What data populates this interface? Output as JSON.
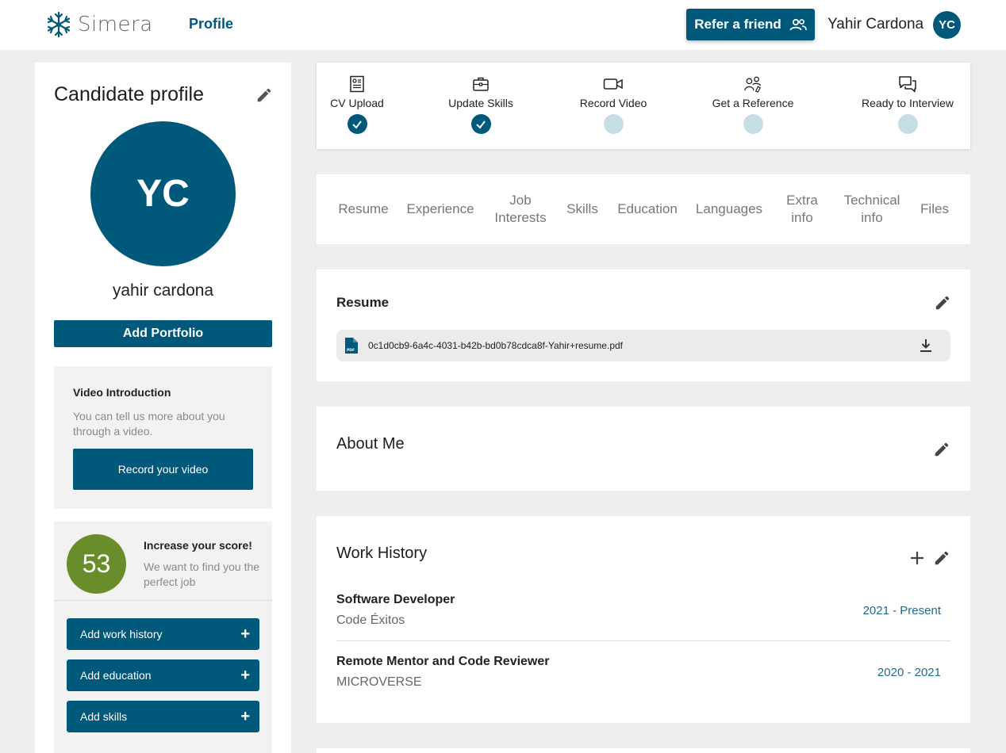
{
  "header": {
    "logo_text": "Simera",
    "nav_label": "Profile",
    "refer_label": "Refer a friend",
    "user_name": "Yahir Cardona",
    "user_initials": "YC"
  },
  "profile": {
    "title": "Candidate profile",
    "initials": "YC",
    "name": "yahir cardona",
    "add_portfolio": "Add Portfolio",
    "video": {
      "title": "Video Introduction",
      "description": "You can tell us more about you through a video.",
      "button": "Record your video"
    },
    "score": {
      "value": "53",
      "title": "Increase your score!",
      "description": "We want to find you the perfect job"
    },
    "actions": [
      {
        "label": "Add work history"
      },
      {
        "label": "Add education"
      },
      {
        "label": "Add skills"
      }
    ]
  },
  "steps": [
    {
      "label": "CV Upload",
      "icon": "cv-icon",
      "done": true
    },
    {
      "label": "Update Skills",
      "icon": "briefcase-icon",
      "done": true
    },
    {
      "label": "Record Video",
      "icon": "video-camera-icon",
      "done": false
    },
    {
      "label": "Get a Reference",
      "icon": "reference-icon",
      "done": false
    },
    {
      "label": "Ready to Interview",
      "icon": "chat-icon",
      "done": false
    }
  ],
  "tabs": [
    "Resume",
    "Experience",
    "Job Interests",
    "Skills",
    "Education",
    "Languages",
    "Extra info",
    "Technical info",
    "Files"
  ],
  "resume": {
    "title": "Resume",
    "file_name": "0c1d0cb9-6a4c-4031-b42b-bd0b78cdca8f-Yahir+resume.pdf"
  },
  "about": {
    "title": "About Me"
  },
  "work_history": {
    "title": "Work History",
    "jobs": [
      {
        "title": "Software Developer",
        "company": "Code Éxitos",
        "dates": "2021 - Present"
      },
      {
        "title": "Remote Mentor and Code Reviewer",
        "company": "MICROVERSE",
        "dates": "2020 - 2021"
      }
    ]
  },
  "colors": {
    "primary": "#00597a",
    "score": "#6a8d2c",
    "step_pending": "#c6dde6"
  }
}
